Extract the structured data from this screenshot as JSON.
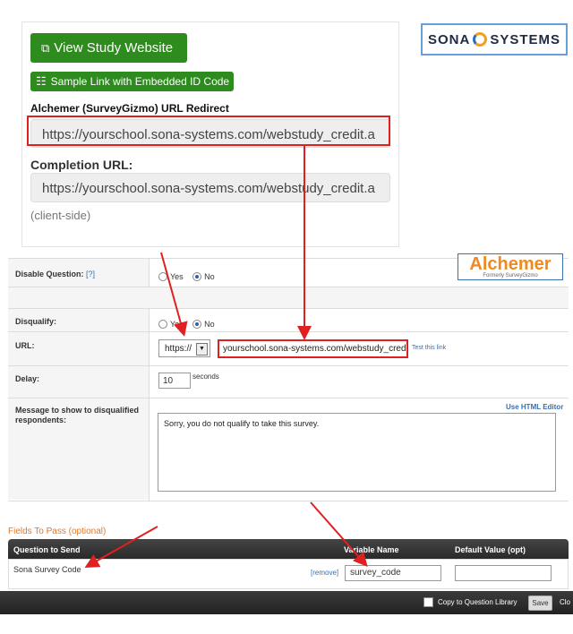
{
  "sona": {
    "view_button": "View Study Website",
    "sample_button": "Sample Link with Embedded ID Code",
    "redirect_label": "Alchemer (SurveyGizmo) URL Redirect",
    "redirect_url": "https://yourschool.sona-systems.com/webstudy_credit.a",
    "completion_label": "Completion URL:",
    "completion_url": "https://yourschool.sona-systems.com/webstudy_credit.a",
    "client_side": "(client-side)",
    "logo_left": "SONA",
    "logo_right": "SYSTEMS"
  },
  "alchemer": {
    "logo": "Alchemer",
    "logo_sub": "Formerly SurveyGizmo",
    "disable_label": "Disable Question:",
    "help": "[?]",
    "yes": "Yes",
    "no": "No",
    "disqualify_label": "Disqualify:",
    "url_label": "URL:",
    "protocol": "https://",
    "url_value": "yourschool.sona-systems.com/webstudy_cred",
    "test_link": "Test this link",
    "delay_label": "Delay:",
    "delay_value": "10",
    "seconds": "seconds",
    "message_label": "Message to show to disqualified respondents:",
    "use_html": "Use HTML Editor",
    "message": "Sorry, you do not qualify to take this survey."
  },
  "fields": {
    "title": "Fields To Pass (optional)",
    "col_question": "Question to Send",
    "col_variable": "Variable Name",
    "col_default": "Default Value (opt)",
    "row_question": "Sona Survey Code",
    "remove": "[remove]",
    "variable_value": "survey_code"
  },
  "footer": {
    "copy_label": "Copy to Question Library",
    "save": "Save",
    "close": "Clo"
  },
  "colors": {
    "accent_green": "#2e8b1e",
    "highlight_red": "#e02020",
    "alchemer_orange": "#f08a1e",
    "link_blue": "#3a6fb0"
  }
}
